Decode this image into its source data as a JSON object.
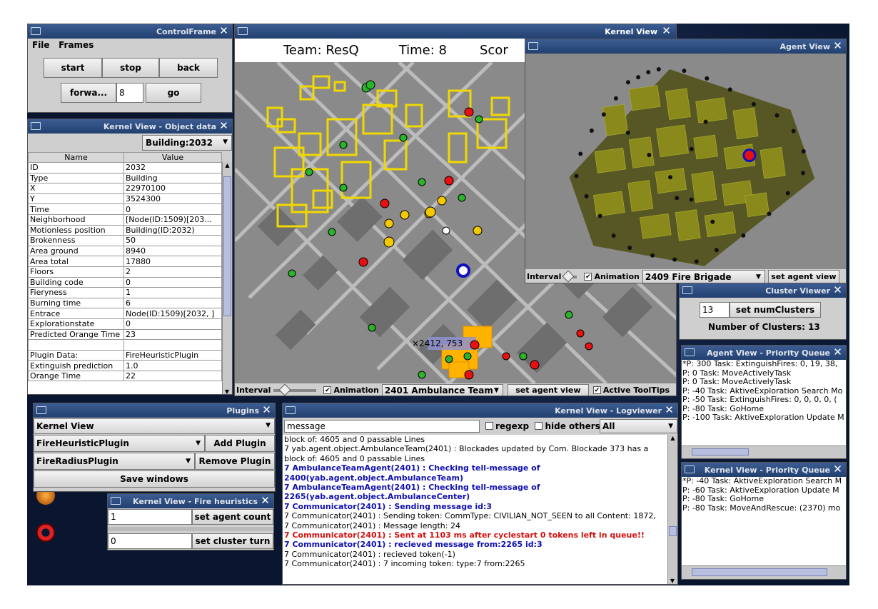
{
  "control_frame": {
    "title": "ControlFrame",
    "menu": [
      "File",
      "Frames"
    ],
    "start": "start",
    "stop": "stop",
    "back": "back",
    "forward": "forwa...",
    "step_value": "8",
    "go": "go"
  },
  "object_data": {
    "title": "Kernel View - Object data",
    "selected": "Building:2032",
    "col_name": "Name",
    "col_value": "Value",
    "rows": [
      [
        "ID",
        "2032"
      ],
      [
        "Type",
        "Building"
      ],
      [
        "X",
        "22970100"
      ],
      [
        "Y",
        "3524300"
      ],
      [
        "Time",
        "0"
      ],
      [
        "Neighborhood",
        "[Node(ID:1509)[203..."
      ],
      [
        "Motionless position",
        "Building(ID:2032)"
      ],
      [
        "Brokenness",
        "50"
      ],
      [
        "Area ground",
        "8940"
      ],
      [
        "Area total",
        "17880"
      ],
      [
        "Floors",
        "2"
      ],
      [
        "Building code",
        "0"
      ],
      [
        "Fieryness",
        "1"
      ],
      [
        "Burning time",
        "6"
      ],
      [
        "Entrace",
        "Node(ID:1509)[2032, ]"
      ],
      [
        "Explorationstate",
        "0"
      ],
      [
        "Predicted Orange Time",
        "23"
      ],
      [
        "",
        ""
      ],
      [
        "Plugin Data:",
        "FireHeuristicPlugin"
      ],
      [
        "Extinguish prediction",
        "1.0"
      ],
      [
        "Orange Time",
        "22"
      ]
    ]
  },
  "kernel_view": {
    "title": "Kernel View",
    "team": "Team: ResQ",
    "time": "Time: 8",
    "score": "Scor",
    "tooltip": "×2412, 753",
    "interval": "Interval",
    "animation": "Animation",
    "agent": "2401 Ambulance Team",
    "set_agent_view": "set agent view",
    "active_tooltips": "Active ToolTips"
  },
  "agent_view": {
    "title": "Agent View",
    "interval": "Interval",
    "animation": "Animation",
    "agent": "2409 Fire Brigade",
    "set_agent_view": "set agent view"
  },
  "cluster_viewer": {
    "title": "Cluster Viewer",
    "value": "13",
    "button": "set numClusters",
    "label": "Number of Clusters: 13"
  },
  "agent_pq": {
    "title": "Agent View - Priority Queue",
    "items": [
      "*P: 300 Task: ExtinguishFires: 0, 19, 38,",
      "P: 0 Task: MoveActivelyTask",
      "P: 0 Task: MoveActivelyTask",
      "P: -40 Task: AktiveExploration Search Mo",
      "P: -50 Task: ExtinguishFires: 0, 0, 0, 0, (",
      "P: -80 Task: GoHome",
      "P: -100 Task: AktiveExploration Update M"
    ]
  },
  "kernel_pq": {
    "title": "Kernel View - Priority Queue",
    "items": [
      "*P: -40 Task: AktiveExploration Search M",
      "P: -60 Task: AktiveExploration Update M",
      "P: -80 Task: GoHome",
      "P: -80 Task: MoveAndRescue: (2370) mo"
    ]
  },
  "plugins": {
    "title": "Plugins",
    "view": "Kernel View",
    "plugin1": "FireHeuristicPlugin",
    "add": "Add Plugin",
    "plugin2": "FireRadiusPlugin",
    "remove": "Remove Plugin",
    "save": "Save windows"
  },
  "fire_heuristics": {
    "title": "Kernel View - Fire heuristics",
    "count_value": "1",
    "count_btn": "set agent count",
    "turn_value": "0",
    "turn_btn": "set cluster turn"
  },
  "logviewer": {
    "title": "Kernel View - Logviewer",
    "filter": "message",
    "regexp": "regexp",
    "hide_others": "hide others",
    "level": "All",
    "lines": [
      {
        "t": "block of: 4605 and 0 passable Lines",
        "c": ""
      },
      {
        "t": "7 yab.agent.object.AmbulanceTeam(2401) : Blockades updated by Com. Blockade 373 has a",
        "c": ""
      },
      {
        "t": "block of: 4605 and 0 passable Lines",
        "c": ""
      },
      {
        "t": "7 AmbulanceTeamAgent(2401) : Checking tell-message of",
        "c": "b"
      },
      {
        "t": "2400(yab.agent.object.AmbulanceTeam)",
        "c": "b"
      },
      {
        "t": "7 AmbulanceTeamAgent(2401) : Checking tell-message of",
        "c": "b"
      },
      {
        "t": "2265(yab.agent.object.AmbulanceCenter)",
        "c": "b"
      },
      {
        "t": "7 Communicator(2401) : Sending message id:3",
        "c": "b"
      },
      {
        "t": "7 Communicator(2401) : Sending token: CommType: CIVILIAN_NOT_SEEN to all Content: 1872,",
        "c": ""
      },
      {
        "t": "7 Communicator(2401) : Message length: 24",
        "c": ""
      },
      {
        "t": "7 Communicator(2401) : Sent at 1103 ms after cyclestart 0 tokens left in queue!!",
        "c": "r"
      },
      {
        "t": "7 Communicator(2401) : recieved message from:2265 id:3",
        "c": "b"
      },
      {
        "t": "7 Communicator(2401) : recieved token(-1)",
        "c": ""
      },
      {
        "t": "7 Communicator(2401) : 7 incoming token: type:7 from:2265",
        "c": ""
      }
    ]
  },
  "colors": {
    "titlebar": "#2b4a7e",
    "fire": "#e8cf00",
    "burning": "#ffb000",
    "civilian": "#2db52d",
    "injured": "#e01010"
  }
}
